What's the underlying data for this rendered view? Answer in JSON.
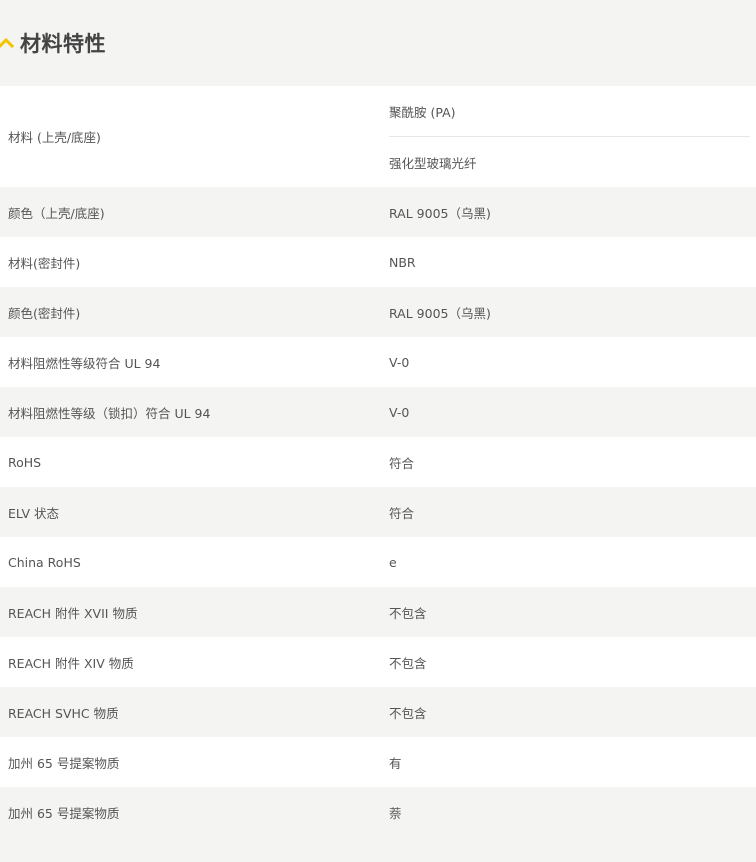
{
  "section": {
    "title": "材料特性",
    "toggle_icon": "chevron-up-icon",
    "accent_color": "#f5c400"
  },
  "specs": [
    {
      "label": "材料 (上壳/底座)",
      "values": [
        "聚酰胺 (PA)",
        "强化型玻璃光纤"
      ]
    },
    {
      "label": "颜色（上壳/底座)",
      "values": [
        "RAL 9005（乌黑)"
      ]
    },
    {
      "label": "材料(密封件)",
      "values": [
        "NBR"
      ]
    },
    {
      "label": "颜色(密封件)",
      "values": [
        "RAL 9005（乌黑)"
      ]
    },
    {
      "label": "材料阻燃性等级符合 UL 94",
      "values": [
        "V-0"
      ]
    },
    {
      "label": "材料阻燃性等级（锁扣）符合 UL 94",
      "values": [
        "V-0"
      ]
    },
    {
      "label": "RoHS",
      "values": [
        "符合"
      ]
    },
    {
      "label": "ELV 状态",
      "values": [
        "符合"
      ]
    },
    {
      "label": "China RoHS",
      "values": [
        "e"
      ]
    },
    {
      "label": "REACH 附件 XVII 物质",
      "values": [
        "不包含"
      ]
    },
    {
      "label": "REACH 附件 XIV 物质",
      "values": [
        "不包含"
      ]
    },
    {
      "label": "REACH SVHC 物质",
      "values": [
        "不包含"
      ]
    },
    {
      "label": "加州 65 号提案物质",
      "values": [
        "有"
      ]
    },
    {
      "label": "加州 65 号提案物质",
      "values": [
        "萘"
      ]
    }
  ]
}
